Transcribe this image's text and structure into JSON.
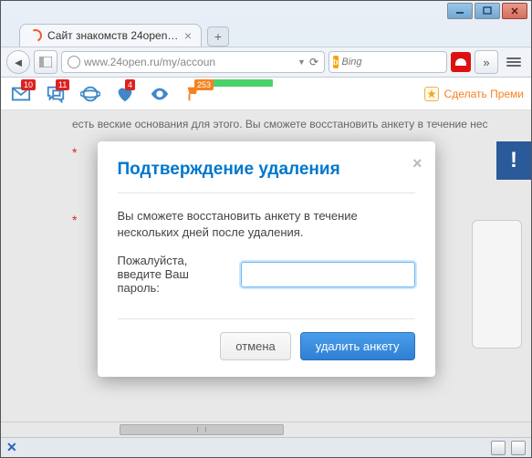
{
  "browser": {
    "tab": {
      "title": "Сайт знакомств 24open.ru..."
    },
    "url": "www.24open.ru/my/accoun",
    "search": {
      "engine": "Bing",
      "placeholder": "Bing"
    }
  },
  "sitebar": {
    "badges": {
      "mail": "10",
      "chat": "11",
      "flag": "253",
      "heart": "4"
    },
    "premium": "Сделать Преми"
  },
  "bg": {
    "line": "есть веские основания для этого. Вы сможете восстановить анкету в течение нес",
    "excl": "!"
  },
  "dialog": {
    "title": "Подтверждение удаления",
    "text1": "Вы cможете восстановить анкету в течение нескольких дней после удаления.",
    "pwlabel": "Пожалуйста, введите Ваш пароль:",
    "cancel": "отмена",
    "confirm": "удалить анкету"
  }
}
